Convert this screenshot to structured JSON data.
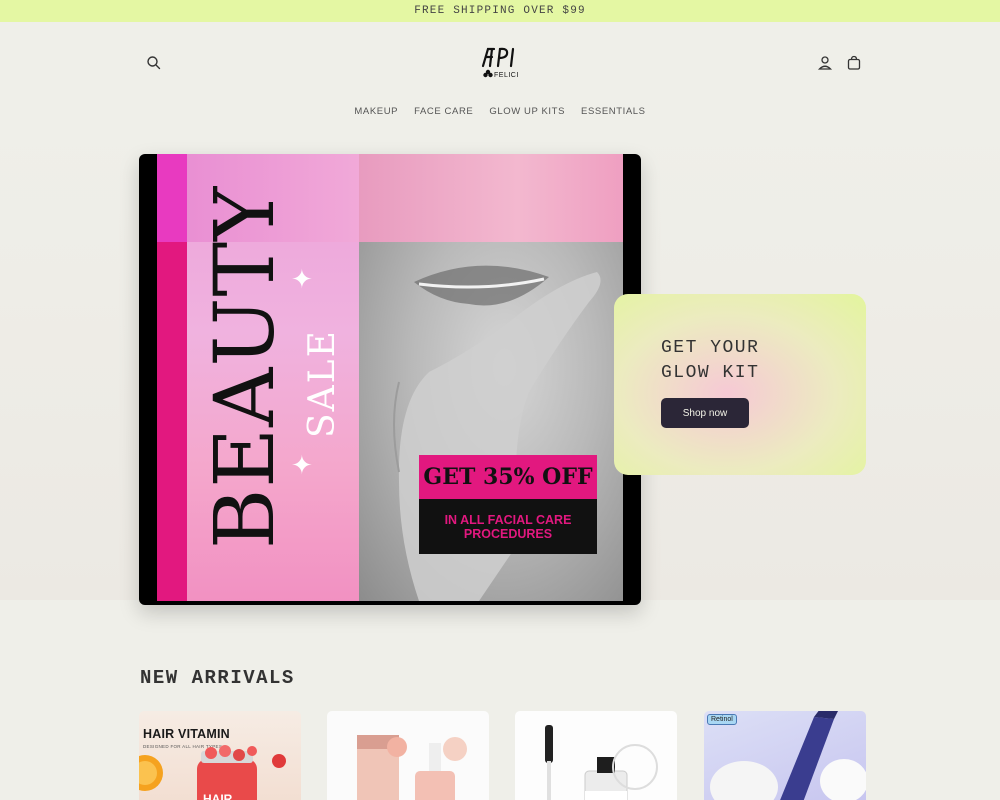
{
  "announcement": "FREE SHIPPING OVER $99",
  "header": {
    "search_icon": "search-icon",
    "account_icon": "user-icon",
    "cart_icon": "bag-icon",
    "logo": {
      "line1": "APi",
      "line2": "FELICI"
    }
  },
  "nav": {
    "items": [
      {
        "label": "MAKEUP"
      },
      {
        "label": "FACE CARE"
      },
      {
        "label": "GLOW UP KITS"
      },
      {
        "label": "ESSENTIALS"
      }
    ]
  },
  "hero": {
    "banner": {
      "headline": "BEAUTY",
      "subheadline": "SALE",
      "offer": "GET 35% OFF",
      "offer_detail": "IN ALL FACIAL CARE PROCEDURES"
    },
    "promo": {
      "title_line1": "GET YOUR",
      "title_line2": "GLOW KIT",
      "button_label": "Shop now"
    }
  },
  "new_arrivals": {
    "title": "NEW ARRIVALS",
    "products": [
      {
        "image_text": "HAIR VITAMIN",
        "image_subtext": "DESIGNED FOR ALL HAIR TYPES"
      },
      {
        "image_text": ""
      },
      {
        "image_text": ""
      },
      {
        "image_text": "Retinol"
      }
    ]
  },
  "colors": {
    "announcement_bg": "#e4f7a3",
    "page_bg": "#efefe9",
    "accent_pink": "#e2187f",
    "button_dark": "#2b2637"
  }
}
